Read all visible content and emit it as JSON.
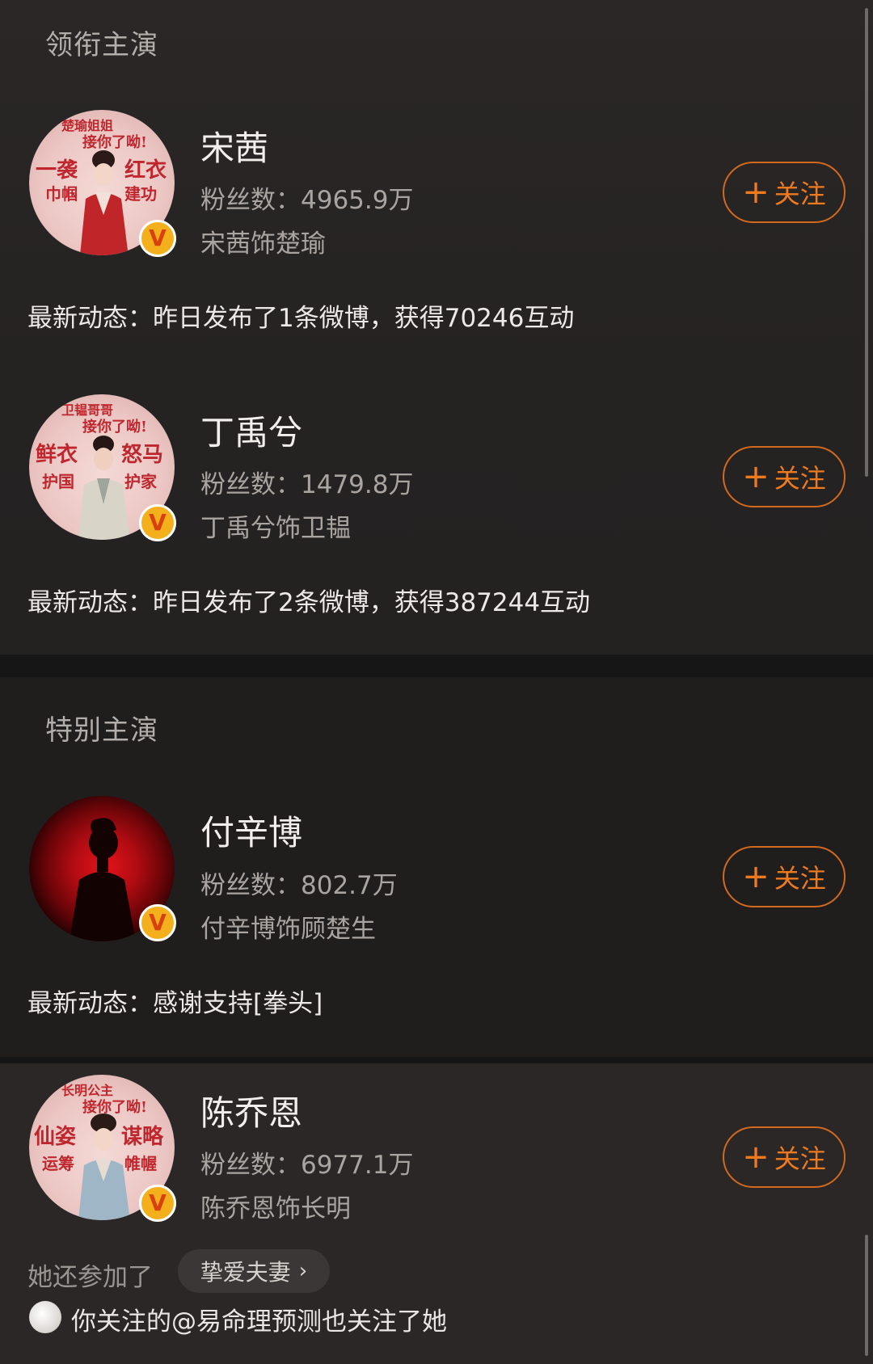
{
  "sections": [
    {
      "title": "领衔主演"
    },
    {
      "title": "特别主演"
    }
  ],
  "cards": [
    {
      "name": "宋茜",
      "fans": "粉丝数：4965.9万",
      "role": "宋茜饰楚瑜",
      "follow_label": "关注",
      "news": "最新动态：昨日发布了1条微博，获得70246互动",
      "poster": [
        "楚瑜姐姐",
        "接你了呦!",
        "一袭",
        "红衣",
        "巾帼",
        "建功"
      ]
    },
    {
      "name": "丁禹兮",
      "fans": "粉丝数：1479.8万",
      "role": "丁禹兮饰卫韫",
      "follow_label": "关注",
      "news": "最新动态：昨日发布了2条微博，获得387244互动",
      "poster": [
        "卫韫哥哥",
        "接你了呦!",
        "鲜衣",
        "怒马",
        "护国",
        "护家"
      ]
    },
    {
      "name": "付辛博",
      "fans": "粉丝数：802.7万",
      "role": "付辛博饰顾楚生",
      "follow_label": "关注",
      "news": "最新动态：感谢支持[拳头]"
    },
    {
      "name": "陈乔恩",
      "fans": "粉丝数：6977.1万",
      "role": "陈乔恩饰长明",
      "follow_label": "关注",
      "poster": [
        "长明公主",
        "接你了呦!",
        "仙姿",
        "谋略",
        "运筹",
        "帷幄"
      ]
    }
  ],
  "verified_badge": "V",
  "extra": {
    "join_label": "她还参加了",
    "chip_label": "挚爱夫妻",
    "mutual_text": "你关注的@易命理预测也关注了她"
  },
  "colors": {
    "accent": "#ef7a1e",
    "badge": "#f3b01c"
  }
}
